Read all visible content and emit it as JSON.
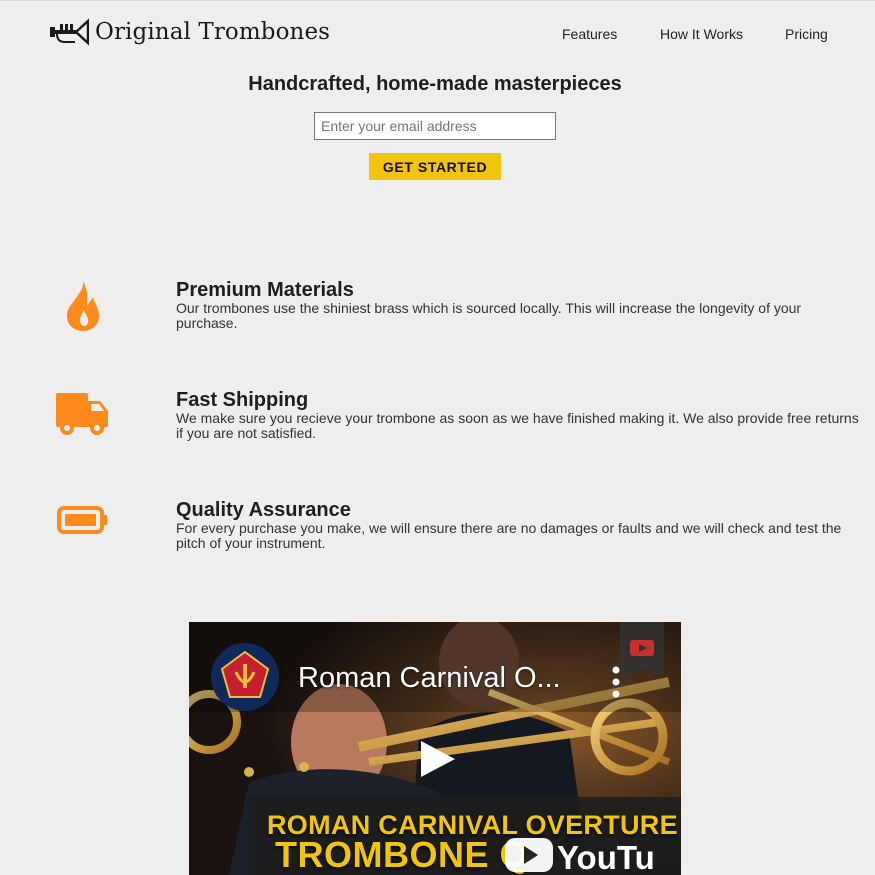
{
  "brand": {
    "name": "Original Trombones",
    "logo_icon": "trumpet-icon"
  },
  "nav": {
    "items": [
      {
        "label": "Features"
      },
      {
        "label": "How It Works"
      },
      {
        "label": "Pricing"
      }
    ]
  },
  "hero": {
    "title": "Handcrafted, home-made masterpieces",
    "email_placeholder": "Enter your email address",
    "email_value": "",
    "cta_label": "GET STARTED"
  },
  "features": [
    {
      "icon": "fire-icon",
      "title": "Premium Materials",
      "description": "Our trombones use the shiniest brass which is sourced locally. This will increase the longevity of your purchase."
    },
    {
      "icon": "truck-icon",
      "title": "Fast Shipping",
      "description": "We make sure you recieve your trombone as soon as we have finished making it. We also provide free returns if you are not satisfied."
    },
    {
      "icon": "battery-icon",
      "title": "Quality Assurance",
      "description": "For every purchase you make, we will ensure there are no damages or faults and we will check and test the pitch of your instrument."
    }
  ],
  "video": {
    "title": "Roman Carnival O...",
    "banner_line1": "ROMAN CARNIVAL OVERTURE",
    "banner_line2": "TROMBONE Q",
    "platform": "YouTube"
  },
  "colors": {
    "accent": "#f1c40f",
    "icon_orange": "#ff8a1c",
    "background": "#eeeeee"
  }
}
